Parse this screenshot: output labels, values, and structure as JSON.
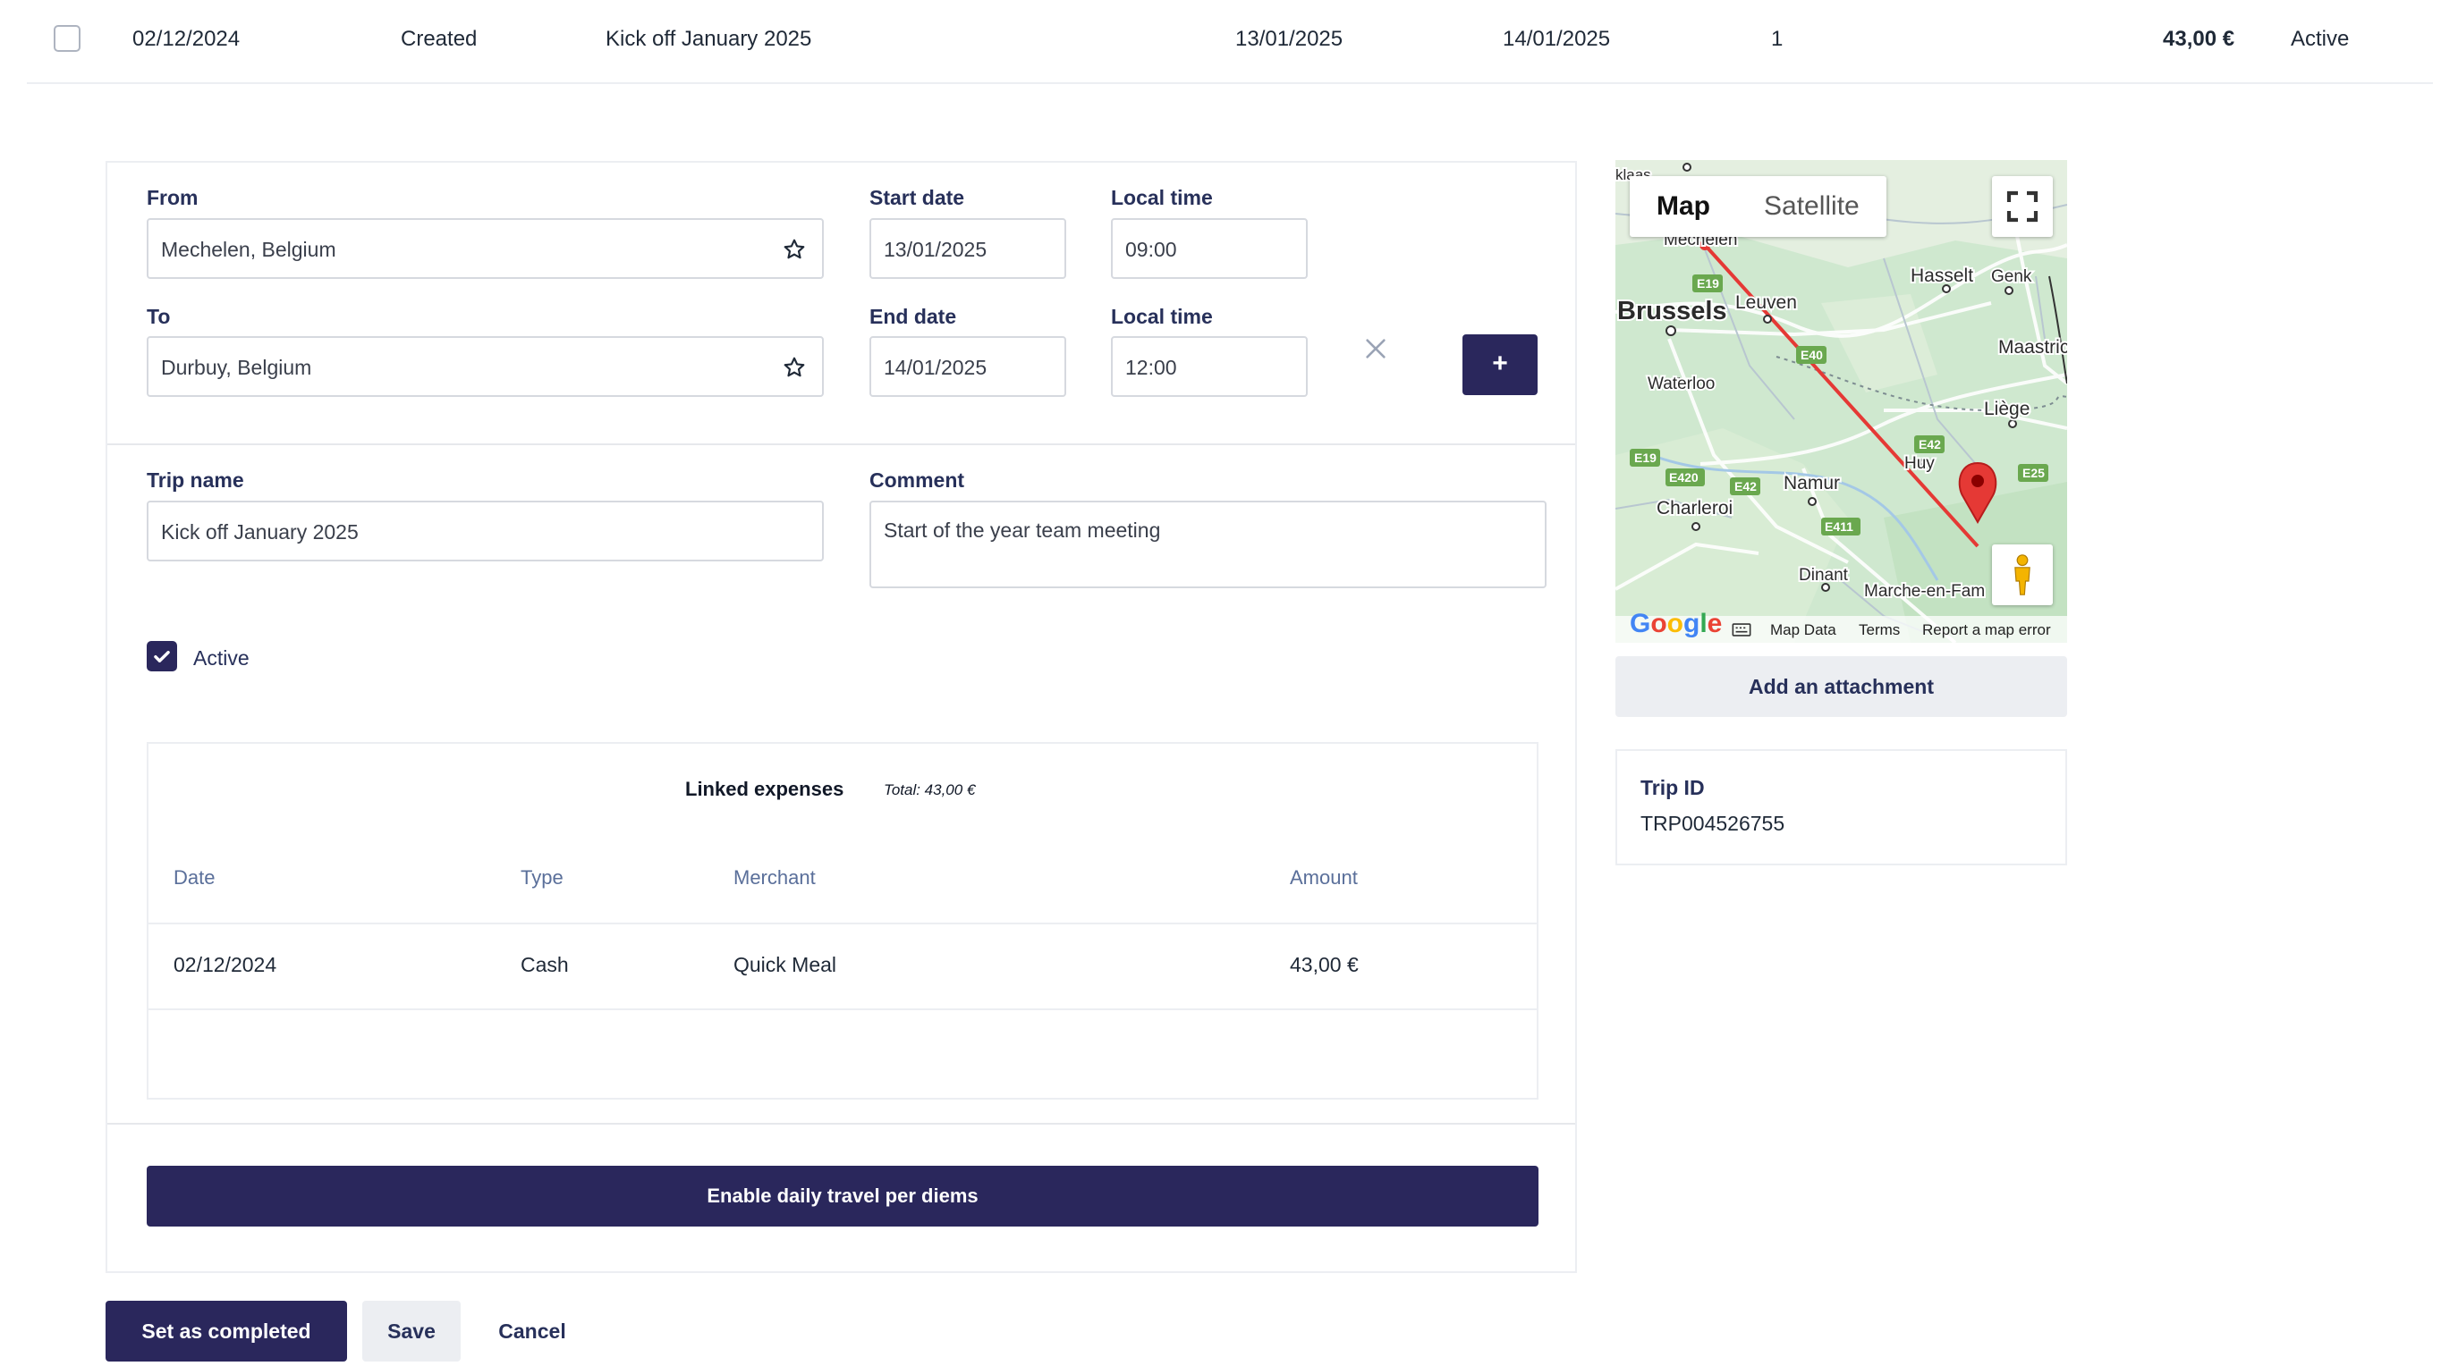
{
  "top_row": {
    "date": "02/12/2024",
    "status": "Created",
    "trip_name": "Kick off January 2025",
    "start_date": "13/01/2025",
    "end_date": "14/01/2025",
    "count": "1",
    "amount": "43,00 €",
    "state": "Active"
  },
  "route": {
    "from_label": "From",
    "from_value": "Mechelen, Belgium",
    "to_label": "To",
    "to_value": "Durbuy, Belgium",
    "start_date_label": "Start date",
    "start_date_value": "13/01/2025",
    "start_time_label": "Local time",
    "start_time_value": "09:00",
    "end_date_label": "End date",
    "end_date_value": "14/01/2025",
    "end_time_label": "Local time",
    "end_time_value": "12:00",
    "add_step_label": "+"
  },
  "details": {
    "trip_name_label": "Trip name",
    "trip_name_value": "Kick off January 2025",
    "comment_label": "Comment",
    "comment_value": "Start of the year team meeting",
    "active_label": "Active",
    "active_checked": true
  },
  "expenses": {
    "title": "Linked expenses",
    "total": "Total: 43,00 €",
    "columns": [
      "Date",
      "Type",
      "Merchant",
      "Amount"
    ],
    "rows": [
      [
        "02/12/2024",
        "Cash",
        "Quick Meal",
        "43,00 €"
      ]
    ]
  },
  "per_diem_button": "Enable daily travel per diems",
  "actions": {
    "complete": "Set as completed",
    "save": "Save",
    "cancel": "Cancel"
  },
  "map": {
    "tab_map": "Map",
    "tab_satellite": "Satellite",
    "google": "Google",
    "footer_data": "Map Data",
    "footer_terms": "Terms",
    "footer_report": "Report a map error",
    "places": {
      "brussels": "Brussels",
      "leuven": "Leuven",
      "mechelen": "Mechelen",
      "hasselt": "Hasselt",
      "genk": "Genk",
      "maastricht": "Maastric",
      "waterloo": "Waterloo",
      "liege": "Liège",
      "huy": "Huy",
      "namur": "Namur",
      "charleroi": "Charleroi",
      "dinant": "Dinant",
      "marche": "Marche-en-Fam",
      "klass": "klaas"
    },
    "roads": [
      "E19",
      "E40",
      "E42",
      "E19",
      "E420",
      "E42",
      "E411",
      "E25"
    ]
  },
  "attachment_button": "Add an attachment",
  "trip_id": {
    "label": "Trip ID",
    "value": "TRP004526755"
  },
  "colors": {
    "primary": "#2a275c",
    "label": "#27305a",
    "muted_header": "#5a6f9a",
    "route_line": "#e53935",
    "map_base": "#cfe8cf"
  }
}
